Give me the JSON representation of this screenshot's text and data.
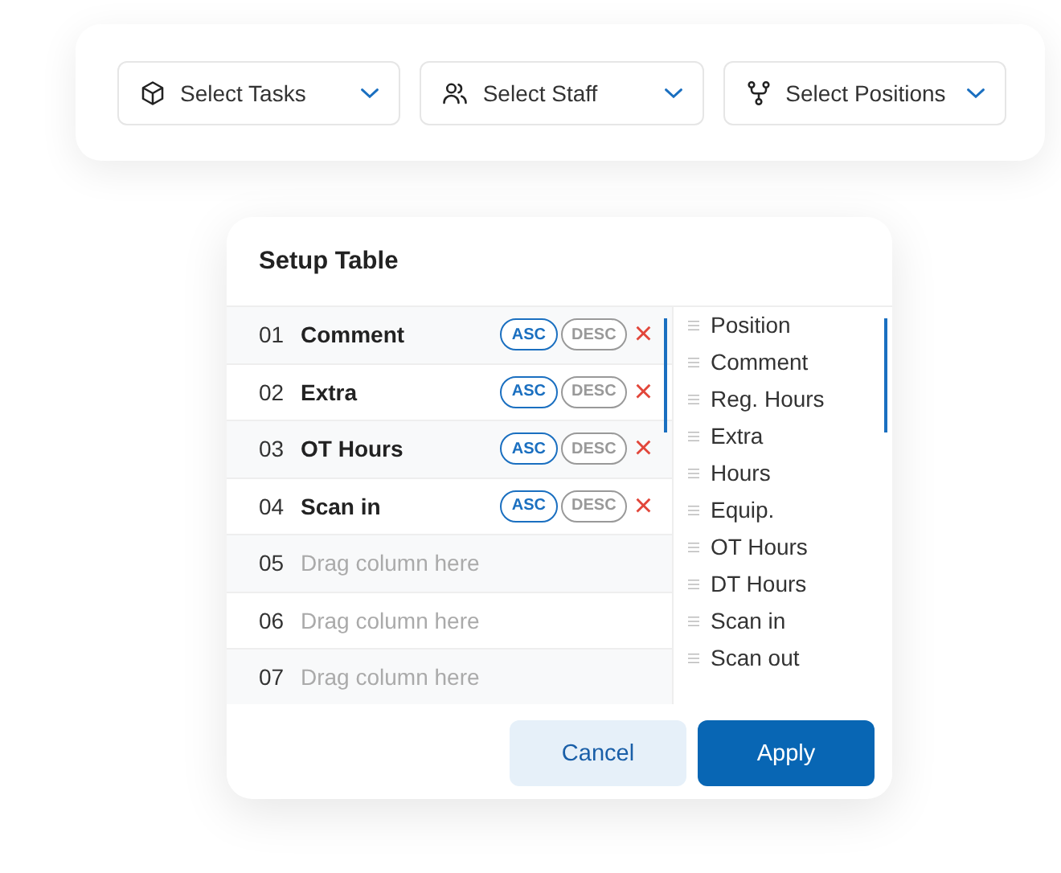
{
  "filters": [
    {
      "label": "Select Tasks"
    },
    {
      "label": "Select Staff"
    },
    {
      "label": "Select Positions"
    }
  ],
  "setup": {
    "title": "Setup Table",
    "rows": [
      {
        "number": "01",
        "name": "Comment",
        "sort": [
          {
            "label": "ASC",
            "selected": true
          },
          {
            "label": "DESC",
            "selected": false
          }
        ],
        "remove": "×"
      },
      {
        "number": "02",
        "name": "Extra",
        "sort": [
          {
            "label": "ASC",
            "selected": true
          },
          {
            "label": "DESC",
            "selected": false
          }
        ],
        "remove": "×"
      },
      {
        "number": "03",
        "name": "OT Hours",
        "sort": [
          {
            "label": "ASC",
            "selected": true
          },
          {
            "label": "DESC",
            "selected": false
          }
        ],
        "remove": "×"
      },
      {
        "number": "04",
        "name": "Scan in",
        "sort": [
          {
            "label": "ASC",
            "selected": true
          },
          {
            "label": "DESC",
            "selected": false
          }
        ],
        "remove": "×"
      },
      {
        "number": "05",
        "placeholder": "Drag column here"
      },
      {
        "number": "06",
        "placeholder": "Drag column here"
      },
      {
        "number": "07",
        "placeholder": "Drag column here"
      }
    ],
    "columns": [
      "Position",
      "Comment",
      "Reg. Hours",
      "Extra",
      "Hours",
      "Equip.",
      "OT Hours",
      "DT Hours",
      "Scan in",
      "Scan out"
    ],
    "buttons": [
      {
        "kind": "secondary",
        "label": "Cancel"
      },
      {
        "kind": "primary",
        "label": "Apply"
      }
    ]
  }
}
